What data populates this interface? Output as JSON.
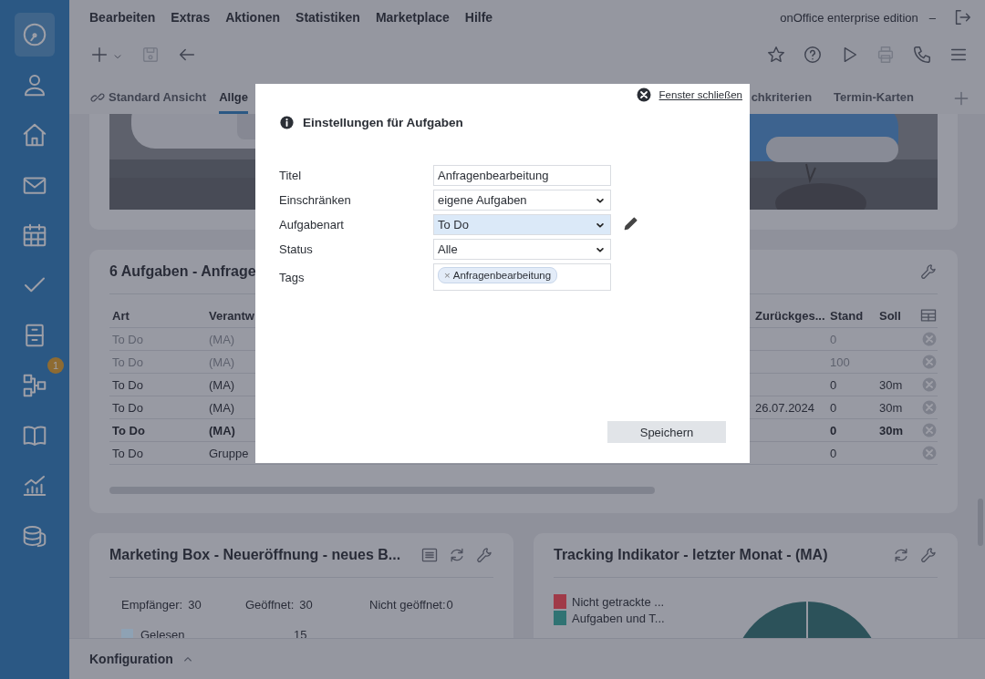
{
  "sidebar": {
    "items": [
      {
        "selected": true
      },
      {
        "selected": false
      },
      {
        "selected": false
      },
      {
        "selected": false
      },
      {
        "selected": false
      },
      {
        "selected": false
      },
      {
        "selected": false
      },
      {
        "selected": false,
        "badge": "1"
      },
      {
        "selected": false
      },
      {
        "selected": false
      },
      {
        "selected": false
      }
    ]
  },
  "menu": [
    "Bearbeiten",
    "Extras",
    "Aktionen",
    "Statistiken",
    "Marketplace",
    "Hilfe"
  ],
  "edition": "onOffice enterprise edition",
  "minimize": "–",
  "toolbar": {
    "left_buttons": [
      {
        "disabled": false
      },
      {
        "disabled": true
      },
      {
        "disabled": false
      }
    ],
    "right_buttons": [
      {
        "disabled": false
      },
      {
        "disabled": false
      },
      {
        "disabled": false
      },
      {
        "disabled": true
      },
      {
        "disabled": false
      },
      {
        "disabled": false
      }
    ]
  },
  "tabs": [
    {
      "label": "Standard Ansicht",
      "linked": true,
      "selected": false
    },
    {
      "label": "Allge",
      "linked": false,
      "selected": true
    },
    {
      "label": "chkriterien",
      "linked": false,
      "selected": false
    },
    {
      "label": "Termin-Karten",
      "linked": false,
      "selected": false
    }
  ],
  "tasks": {
    "title": "6 Aufgaben - Anfrage",
    "columns": [
      "Art",
      "Verantw",
      "Zurückges...",
      "Stand",
      "Soll"
    ],
    "rows": [
      {
        "kind": "done",
        "art": "To Do",
        "verantw": "(MA)",
        "stand": "0"
      },
      {
        "kind": "done",
        "art": "To Do",
        "verantw": "(MA)",
        "stand": "100"
      },
      {
        "kind": "open",
        "art": "To Do",
        "verantw": "(MA)",
        "stand": "0",
        "soll": "30m"
      },
      {
        "kind": "open",
        "art": "To Do",
        "verantw": "(MA)",
        "zurueck": "26.07.2024",
        "stand": "0",
        "soll": "30m"
      },
      {
        "kind": "new",
        "art": "To Do",
        "verantw": "(MA)",
        "stand": "0",
        "soll": "30m"
      },
      {
        "kind": "open",
        "art": "To Do",
        "verantw": "Gruppe",
        "stand": "0"
      }
    ]
  },
  "marketing": {
    "title": "Marketing Box - Neueröffnung - neues B...",
    "stats": [
      {
        "label": "Empfänger:",
        "value": "30"
      },
      {
        "label": "Geöffnet:",
        "value": "30"
      },
      {
        "label": "Nicht geöffnet:",
        "value": "0"
      }
    ],
    "legend": [
      {
        "label": "Gelesen",
        "value": "15",
        "color": "#8ea2b4"
      }
    ]
  },
  "tracking": {
    "title": "Tracking Indikator - letzter Monat - (MA)",
    "legend": [
      {
        "label": "Nicht getrackte ...",
        "color": "#a03a48"
      },
      {
        "label": "Aufgaben und T...",
        "color": "#307373"
      }
    ]
  },
  "footer": {
    "label": "Konfiguration",
    "expanded": false
  },
  "dialog": {
    "close_label": "Fenster schließen",
    "title": "Einstellungen für Aufgaben",
    "fields": [
      {
        "label": "Titel",
        "kind": "text",
        "value": "Anfragenbearbeitung",
        "focused": false
      },
      {
        "label": "Einschränken",
        "kind": "select",
        "value": "eigene Aufgaben",
        "focused": false
      },
      {
        "label": "Aufgabenart",
        "kind": "select",
        "value": "To Do",
        "focused": true,
        "editable": true
      },
      {
        "label": "Status",
        "kind": "select",
        "value": "Alle",
        "focused": false
      },
      {
        "label": "Tags",
        "kind": "tags",
        "tags": [
          {
            "label": "Anfragenbearbeitung",
            "remove": "×"
          }
        ],
        "focused": false
      }
    ],
    "save_label": "Speichern"
  }
}
